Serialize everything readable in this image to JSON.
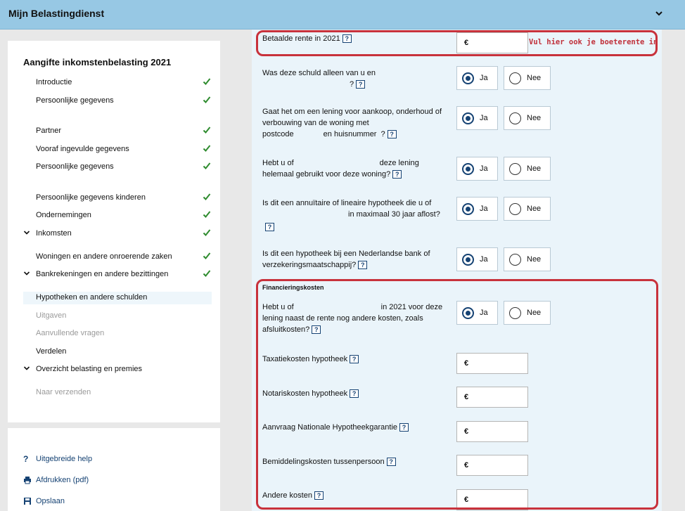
{
  "header": {
    "title": "Mijn Belastingdienst"
  },
  "sidebar": {
    "heading": "Aangifte inkomstenbelasting 2021",
    "items": [
      {
        "label": "Introductie"
      },
      {
        "label": "Persoonlijke gegevens"
      },
      {
        "label": "Partner"
      },
      {
        "label": "Vooraf ingevulde gegevens"
      },
      {
        "label": "Persoonlijke gegevens"
      },
      {
        "label": "Persoonlijke gegevens kinderen"
      },
      {
        "label": "Ondernemingen"
      },
      {
        "label": "Inkomsten"
      },
      {
        "label": "Woningen en andere onroerende zaken"
      },
      {
        "label": "Bankrekeningen en andere bezittingen"
      },
      {
        "label": "Hypotheken en andere schulden"
      },
      {
        "label": "Uitgaven"
      },
      {
        "label": "Aanvullende vragen"
      },
      {
        "label": "Verdelen"
      },
      {
        "label": "Overzicht belasting en premies"
      },
      {
        "label": "Naar verzenden"
      }
    ],
    "help_links": [
      {
        "label": "Uitgebreide help",
        "icon": "question-icon"
      },
      {
        "label": "Afdrukken (pdf)",
        "icon": "printer-icon"
      },
      {
        "label": "Opslaan",
        "icon": "save-icon"
      }
    ]
  },
  "form": {
    "rente": {
      "label": "Betaalde rente in 2021",
      "currency": "€",
      "note": "Vul hier ook je boeterente in"
    },
    "questions": [
      {
        "line1": "Was deze schuld alleen van u en",
        "line2": "?"
      },
      {
        "line1": "Gaat het om een lening voor aankoop, onderhoud of",
        "line2": "verbouwing van de woning met",
        "line3a": "postcode",
        "line3b": "en huisnummer",
        "line3c": "?"
      },
      {
        "line1a": "Hebt u of",
        "line1b": "deze lening",
        "line2": "helemaal gebruikt voor deze woning?"
      },
      {
        "line1": "Is dit een annuïtaire of lineaire hypotheek die u of",
        "line2": "in maximaal 30 jaar aflost?"
      },
      {
        "line1": "Is dit een hypotheek bij een Nederlandse bank of",
        "line2": "verzekeringsmaatschappij?"
      }
    ],
    "radio_yes": "Ja",
    "radio_no": "Nee",
    "section_title": "Financieringskosten",
    "kosten_question": {
      "line1a": "Hebt u of",
      "line1b": "in 2021 voor deze",
      "line2": "lening naast de rente nog andere kosten, zoals",
      "line3": "afsluitkosten?"
    },
    "cost_fields": [
      {
        "label": "Taxatiekosten hypotheek",
        "currency": "€"
      },
      {
        "label": "Notariskosten hypotheek",
        "currency": "€"
      },
      {
        "label": "Aanvraag Nationale Hypotheekgarantie",
        "currency": "€"
      },
      {
        "label": "Bemiddelingskosten tussenpersoon",
        "currency": "€"
      },
      {
        "label": "Andere kosten",
        "currency": "€"
      }
    ],
    "help_glyph": "?"
  },
  "colors": {
    "header_bg": "#97c8e4",
    "accent": "#154273",
    "highlight_red": "#c8323c",
    "check_green": "#2e8b2e"
  }
}
